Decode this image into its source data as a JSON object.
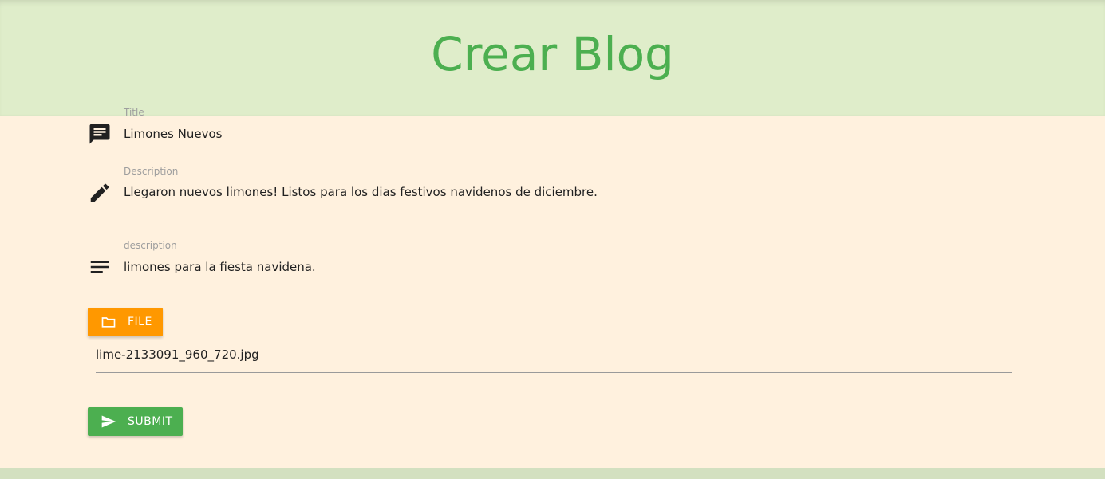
{
  "header": {
    "title": "Crear Blog"
  },
  "form": {
    "title_field": {
      "label": "Title",
      "value": "Limones Nuevos",
      "icon": "comment-icon"
    },
    "description_field": {
      "label": "Description",
      "value": "Llegaron nuevos limones! Listos para los dias festivos navidenos de diciembre.",
      "icon": "pencil-icon"
    },
    "body_field": {
      "label": "description",
      "value": "limones para la fiesta navidena.",
      "icon": "notes-icon"
    },
    "file_button": {
      "label": "FILE",
      "icon": "folder-icon"
    },
    "file_name": {
      "value": "lime-2133091_960_720.jpg"
    },
    "submit_button": {
      "label": "SUBMIT",
      "icon": "send-icon"
    }
  },
  "colors": {
    "header_bg": "#dfedca",
    "title_green": "#4caf50",
    "card_bg": "#fff1de",
    "file_button": "#ff9800",
    "submit_button": "#4caf50"
  }
}
